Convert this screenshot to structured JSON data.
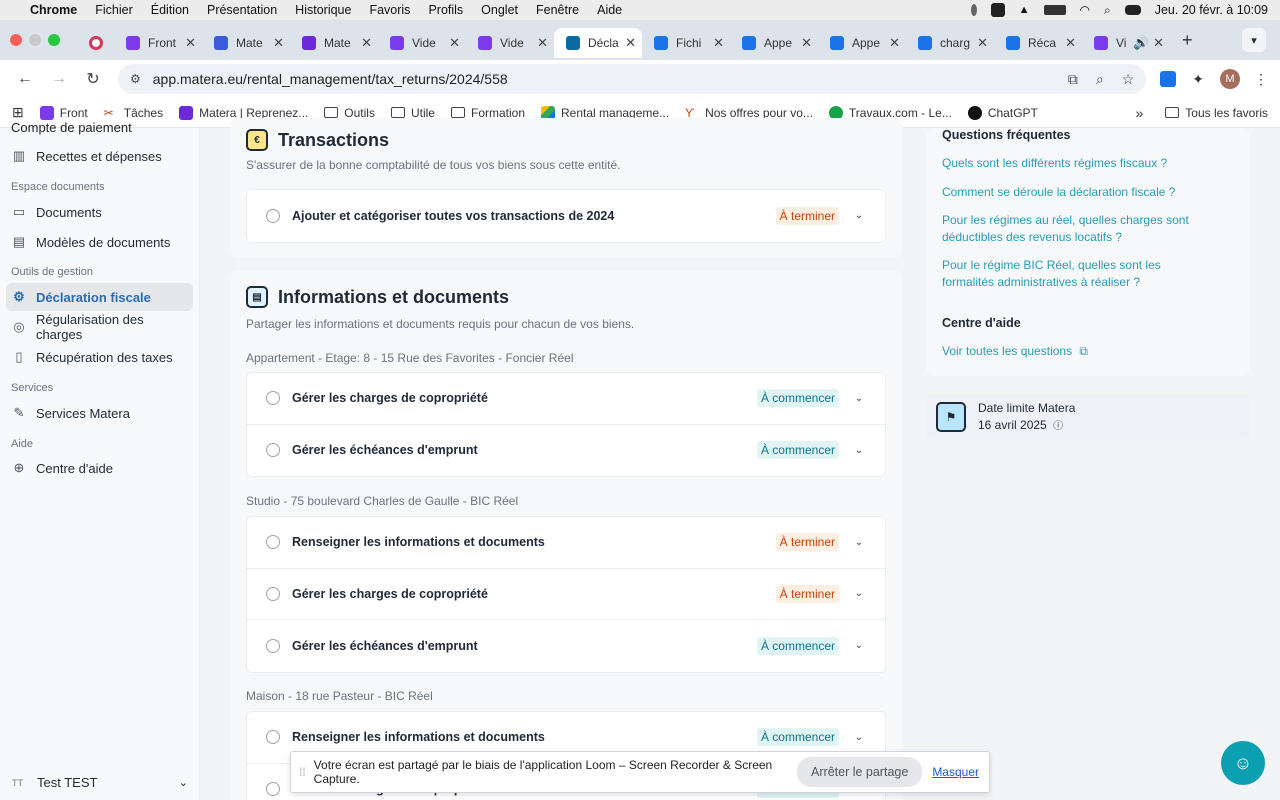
{
  "menubar": {
    "app": "Chrome",
    "items": [
      "Fichier",
      "Édition",
      "Présentation",
      "Historique",
      "Favoris",
      "Profils",
      "Onglet",
      "Fenêtre",
      "Aide"
    ],
    "clock": "Jeu. 20 févr. à 10:09"
  },
  "tabs": [
    {
      "title": "Front",
      "color": "#7c3aed"
    },
    {
      "title": "Mate",
      "color": "#3b5bdb"
    },
    {
      "title": "Mate",
      "color": "#6d28d9"
    },
    {
      "title": "Vide",
      "color": "#7c3aed"
    },
    {
      "title": "Vide",
      "color": "#7c3aed"
    },
    {
      "title": "Décla",
      "color": "#0b6aa2"
    },
    {
      "title": "Fichi",
      "color": "#1a73e8"
    },
    {
      "title": "Appe",
      "color": "#1a73e8"
    },
    {
      "title": "Appe",
      "color": "#1a73e8"
    },
    {
      "title": "charg",
      "color": "#1a73e8"
    },
    {
      "title": "Réca",
      "color": "#1a73e8"
    },
    {
      "title": "Vi",
      "color": "#7c3aed"
    }
  ],
  "address": {
    "url": "app.matera.eu/rental_management/tax_returns/2024/558"
  },
  "bookmarks": {
    "items": [
      "Front",
      "Tâches",
      "Matera | Reprenez...",
      "Outils",
      "Utile",
      "Formation",
      "Rental manageme...",
      "Nos offres pour vo...",
      "Travaux.com - Le...",
      "ChatGPT"
    ],
    "all": "Tous les favoris"
  },
  "sidebar": {
    "clipped": "Compte de paiement",
    "recettes": "Recettes et dépenses",
    "section_documents": "Espace documents",
    "documents": "Documents",
    "modeles": "Modèles de documents",
    "section_outils": "Outils de gestion",
    "declaration": "Déclaration fiscale",
    "regularisation": "Régularisation des charges",
    "recuperation": "Récupération des taxes",
    "section_services": "Services",
    "services_matera": "Services Matera",
    "section_aide": "Aide",
    "centre_aide": "Centre d'aide",
    "user_initials": "TT",
    "user_name": "Test TEST"
  },
  "transactions": {
    "title": "Transactions",
    "subtitle": "S'assurer de la bonne comptabilité de tous vos biens sous cette entité.",
    "task": "Ajouter et catégoriser toutes vos transactions de 2024",
    "status": "À terminer"
  },
  "infos": {
    "title": "Informations et documents",
    "subtitle": "Partager les informations et documents requis pour chacun de vos biens.",
    "groups": [
      {
        "label": "Appartement - Etage: 8 - 15 Rue des Favorites - Foncier Réel",
        "rows": [
          {
            "label": "Gérer les charges de copropriété",
            "status": "À commencer"
          },
          {
            "label": "Gérer les échéances d'emprunt",
            "status": "À commencer"
          }
        ]
      },
      {
        "label": "Studio - 75 boulevard Charles de Gaulle - BIC Réel",
        "rows": [
          {
            "label": "Renseigner les informations et documents",
            "status": "À terminer"
          },
          {
            "label": "Gérer les charges de copropriété",
            "status": "À terminer"
          },
          {
            "label": "Gérer les échéances d'emprunt",
            "status": "À commencer"
          }
        ]
      },
      {
        "label": "Maison - 18 rue Pasteur - BIC Réel",
        "rows": [
          {
            "label": "Renseigner les informations et documents",
            "status": "À commencer"
          },
          {
            "label": "Gérer les charges de copropriété",
            "status": "À commencer"
          }
        ]
      }
    ]
  },
  "faq": {
    "title": "Questions fréquentes",
    "links": [
      "Quels sont les différents régimes fiscaux ?",
      "Comment se déroule la déclaration fiscale ?",
      "Pour les régimes au réel, quelles charges sont déductibles des revenus locatifs ?",
      "Pour le régime BIC Réel, quelles sont les formalités administratives à réaliser ?"
    ],
    "help_title": "Centre d'aide",
    "help_link": "Voir toutes les questions"
  },
  "deadline": {
    "label": "Date limite Matera",
    "date": "16 avril 2025"
  },
  "loom": {
    "message": "Votre écran est partagé par le biais de l'application Loom – Screen Recorder & Screen Capture.",
    "stop": "Arrêter le partage",
    "hide": "Masquer"
  },
  "colors": {
    "accent": "#2b6cb0",
    "link": "#2a9bb5",
    "orange_badge": "#c2410c",
    "teal_badge": "#0e7490",
    "fab": "#0b9fb2"
  }
}
